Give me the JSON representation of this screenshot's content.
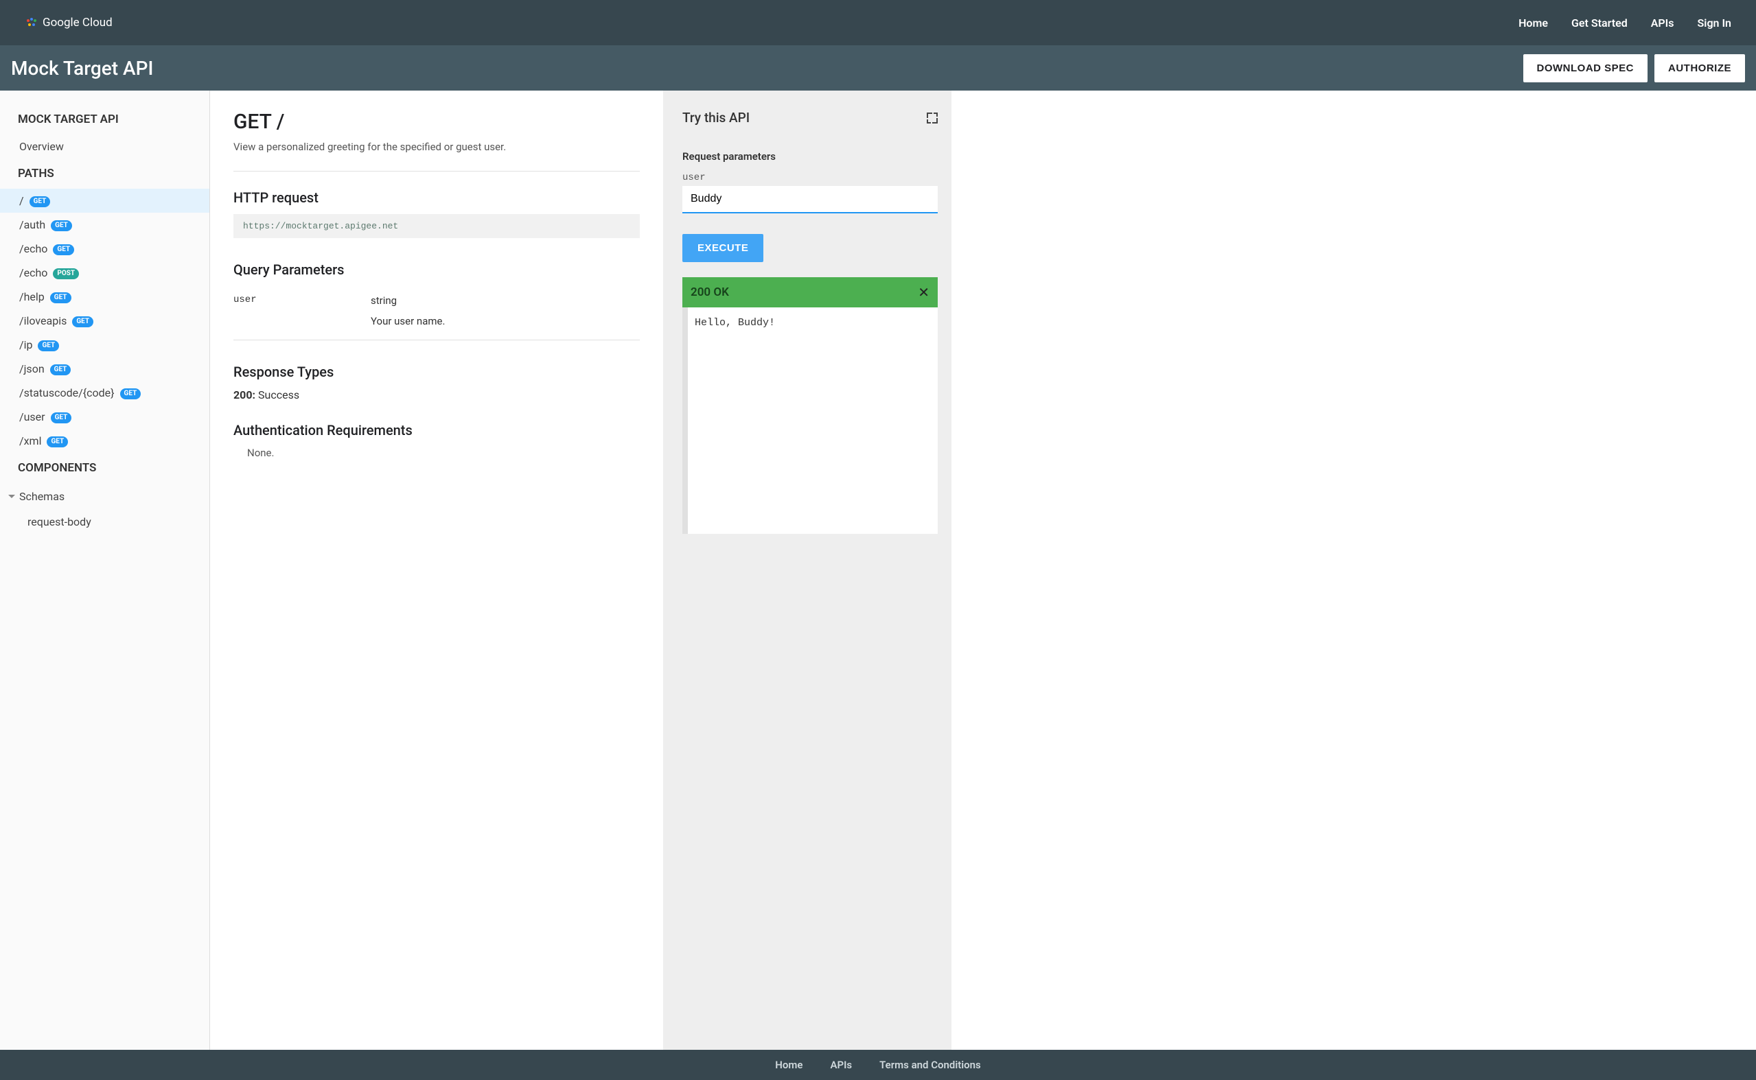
{
  "brand": "Google Cloud",
  "nav": {
    "home": "Home",
    "get_started": "Get Started",
    "apis": "APIs",
    "sign_in": "Sign In"
  },
  "header": {
    "title": "Mock Target API",
    "download": "DOWNLOAD SPEC",
    "authorize": "AUTHORIZE"
  },
  "sidebar": {
    "api_title": "MOCK TARGET API",
    "overview": "Overview",
    "paths_title": "PATHS",
    "paths": [
      {
        "path": "/",
        "method": "GET",
        "active": true
      },
      {
        "path": "/auth",
        "method": "GET"
      },
      {
        "path": "/echo",
        "method": "GET"
      },
      {
        "path": "/echo",
        "method": "POST"
      },
      {
        "path": "/help",
        "method": "GET"
      },
      {
        "path": "/iloveapis",
        "method": "GET"
      },
      {
        "path": "/ip",
        "method": "GET"
      },
      {
        "path": "/json",
        "method": "GET"
      },
      {
        "path": "/statuscode/{code}",
        "method": "GET"
      },
      {
        "path": "/user",
        "method": "GET"
      },
      {
        "path": "/xml",
        "method": "GET"
      }
    ],
    "components_title": "COMPONENTS",
    "schemas_label": "Schemas",
    "schema_item": "request-body"
  },
  "main": {
    "title": "GET /",
    "subtitle": "View a personalized greeting for the specified or guest user.",
    "http_request_heading": "HTTP request",
    "http_url": "https://mocktarget.apigee.net",
    "query_params_heading": "Query Parameters",
    "param": {
      "name": "user",
      "type": "string",
      "desc": "Your user name."
    },
    "response_types_heading": "Response Types",
    "response_code": "200:",
    "response_text": "Success",
    "auth_heading": "Authentication Requirements",
    "auth_none": "None."
  },
  "try": {
    "title": "Try this API",
    "request_params_label": "Request parameters",
    "param_name": "user",
    "param_value": "Buddy",
    "execute": "EXECUTE",
    "status": "200 OK",
    "response": "Hello, Buddy!"
  },
  "footer": {
    "home": "Home",
    "apis": "APIs",
    "terms": "Terms and Conditions"
  }
}
